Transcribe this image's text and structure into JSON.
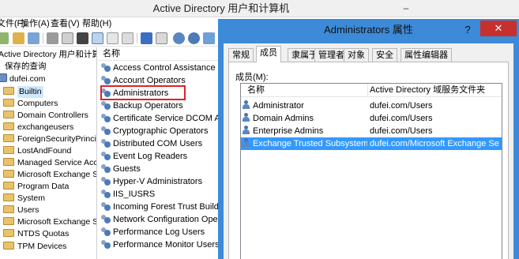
{
  "main_window": {
    "title": "Active Directory 用户和计算机",
    "controls": {
      "minimize": "–",
      "maximize": "□",
      "close": "✕"
    }
  },
  "menu": {
    "items": [
      "文件(F)",
      "操作(A)",
      "查看(V)",
      "帮助(H)"
    ]
  },
  "toolbar": {
    "icons": [
      "back-icon",
      "forward-icon",
      "folder-up-icon",
      "show-tree-icon",
      "cut-icon",
      "copy-icon",
      "delete-icon",
      "properties-icon",
      "refresh-icon",
      "export-icon",
      "help-icon",
      "console-icon",
      "add-user-icon",
      "add-group-icon",
      "filter-icon"
    ]
  },
  "tree": {
    "root_label": "Active Directory 用户和计算机",
    "saved_queries": "保存的查询",
    "domain": "dufei.com",
    "items": [
      "Builtin",
      "Computers",
      "Domain Controllers",
      "exchangeusers",
      "ForeignSecurityPrincip...",
      "LostAndFound",
      "Managed Service Accc",
      "Microsoft Exchange Se",
      "Program Data",
      "System",
      "Users",
      "Microsoft Exchange Sy",
      "NTDS Quotas",
      "TPM Devices"
    ],
    "selected": "Builtin"
  },
  "list": {
    "column_header": "名称",
    "items": [
      "Access Control Assistance Op",
      "Account Operators",
      "Administrators",
      "Backup Operators",
      "Certificate Service DCOM Acce",
      "Cryptographic Operators",
      "Distributed COM Users",
      "Event Log Readers",
      "Guests",
      "Hyper-V Administrators",
      "IIS_IUSRS",
      "Incoming Forest Trust Builder",
      "Network Configuration Opera",
      "Performance Log Users",
      "Performance Monitor Users"
    ],
    "highlighted": "Administrators",
    "highlight_color": "#e0202a"
  },
  "dialog": {
    "title": "Administrators 属性",
    "help_button": "?",
    "close_button": "✕",
    "tabs": [
      "常规",
      "成员",
      "隶属于",
      "管理者",
      "对象",
      "安全",
      "属性编辑器"
    ],
    "active_tab": "成员",
    "members_label": "成员(M):",
    "columns": [
      "名称",
      "Active Directory 域服务文件夹"
    ],
    "members": [
      {
        "name": "Administrator",
        "folder": "dufei.com/Users"
      },
      {
        "name": "Domain Admins",
        "folder": "dufei.com/Users"
      },
      {
        "name": "Enterprise Admins",
        "folder": "dufei.com/Users"
      },
      {
        "name": "Exchange Trusted Subsystem",
        "folder": "dufei.com/Microsoft Exchange Se"
      }
    ],
    "selected_member": "Exchange Trusted Subsystem",
    "accent_color": "#3c8ad8",
    "selection_color": "#3399ff"
  }
}
